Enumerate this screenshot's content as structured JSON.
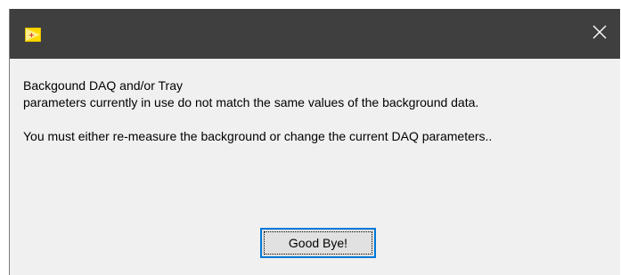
{
  "window": {
    "title": "",
    "app_icon": "labview-vi-icon",
    "close_icon": "close-icon"
  },
  "message": {
    "line1": "Backgound DAQ and/or Tray",
    "line2": "parameters currently in use do not match the same values of the background data.",
    "line3": "You must either re-measure the background or change the current DAQ parameters.."
  },
  "buttons": {
    "ok_label": "Good Bye!"
  },
  "colors": {
    "titlebar": "#3f3f3f",
    "dialog_background": "#f0f0f0",
    "button_focus_border": "#0078d7",
    "icon_yellow": "#ffd800"
  }
}
